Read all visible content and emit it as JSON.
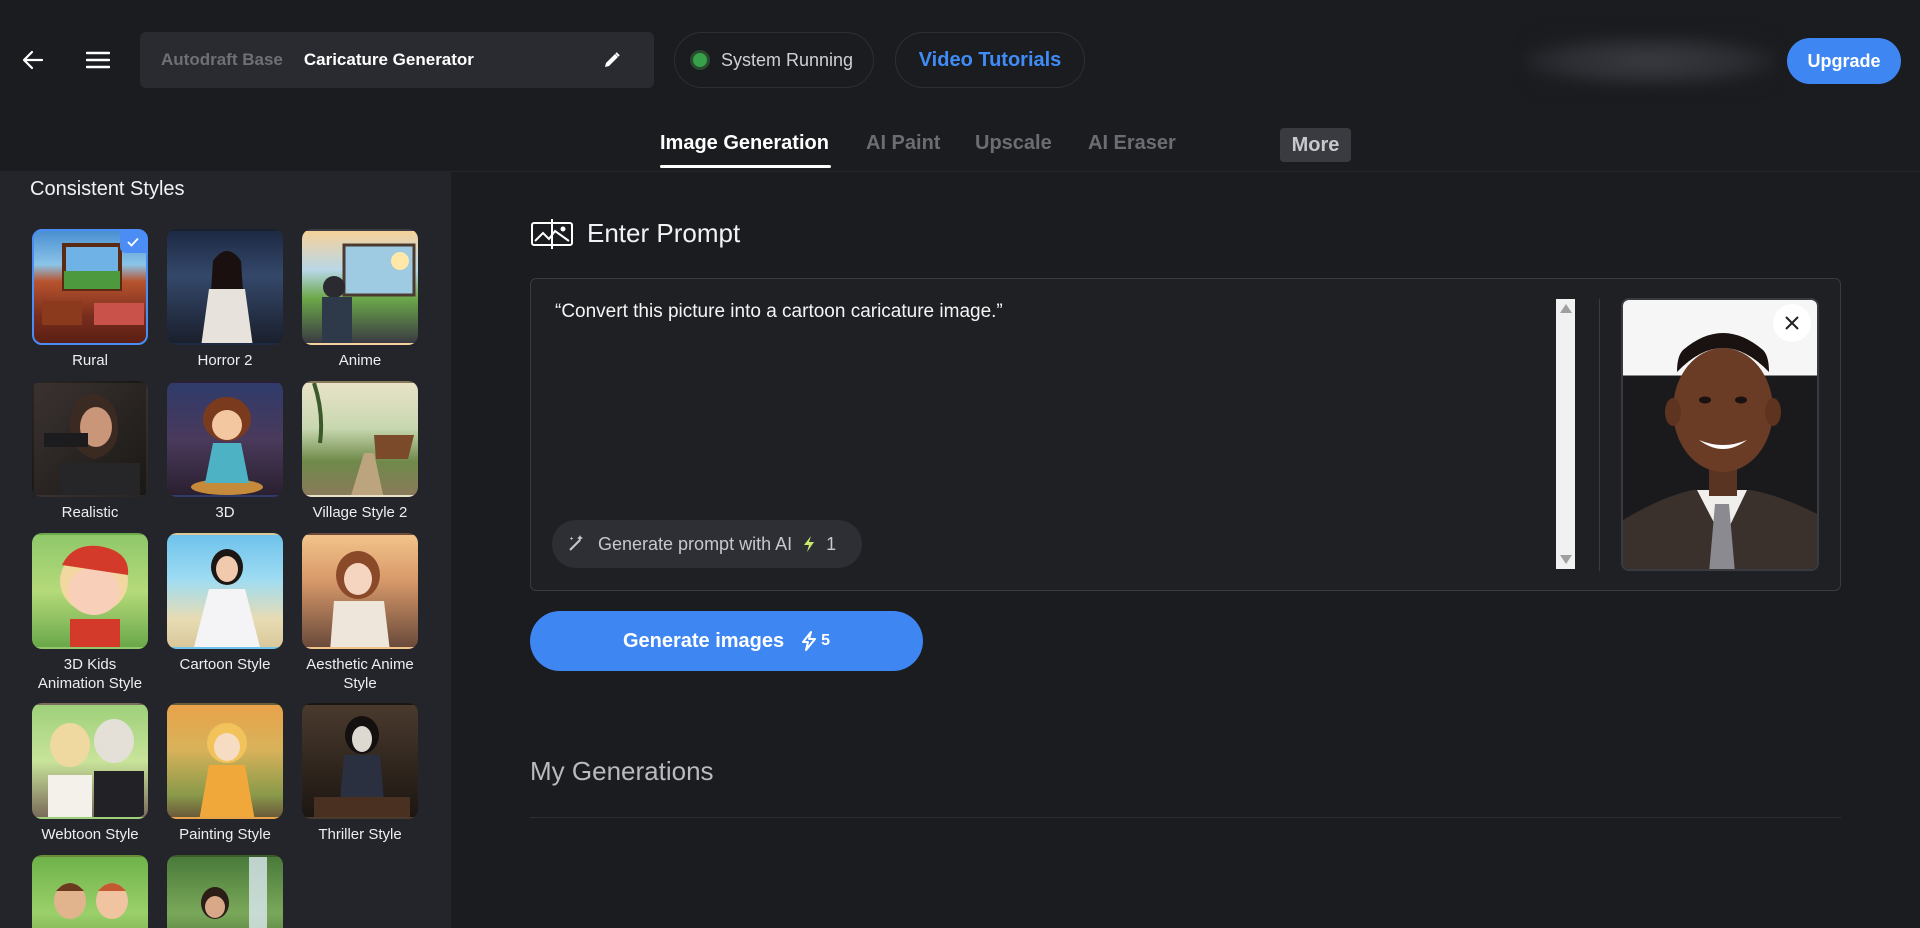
{
  "header": {
    "breadcrumb_base": "Autodraft Base",
    "title": "Caricature Generator",
    "status": "System Running",
    "tutorials": "Video Tutorials",
    "upgrade": "Upgrade"
  },
  "tabs": [
    {
      "label": "Image Generation",
      "active": true
    },
    {
      "label": "AI Paint"
    },
    {
      "label": "Upscale"
    },
    {
      "label": "AI Eraser"
    }
  ],
  "more_label": "More",
  "sidebar": {
    "title": "Consistent Styles",
    "styles": [
      {
        "label": "Rural",
        "selected": true
      },
      {
        "label": "Horror 2"
      },
      {
        "label": "Anime"
      },
      {
        "label": "Realistic"
      },
      {
        "label": "3D"
      },
      {
        "label": "Village Style 2"
      },
      {
        "label": "3D Kids Animation Style"
      },
      {
        "label": "Cartoon Style"
      },
      {
        "label": "Aesthetic Anime Style"
      },
      {
        "label": "Webtoon Style"
      },
      {
        "label": "Painting Style"
      },
      {
        "label": "Thriller Style"
      },
      {
        "label": ""
      },
      {
        "label": ""
      }
    ]
  },
  "prompt": {
    "heading": "Enter Prompt",
    "text": "“Convert this picture into a cartoon caricature image.”",
    "gen_ai_label": "Generate prompt with AI",
    "gen_ai_credits": "1"
  },
  "generate": {
    "label": "Generate images",
    "credits": "5"
  },
  "my_generations": "My Generations",
  "colors": {
    "accent": "#3e86f2",
    "background": "#1b1c20",
    "sidebar": "#24252a",
    "status": "#38a04a"
  }
}
